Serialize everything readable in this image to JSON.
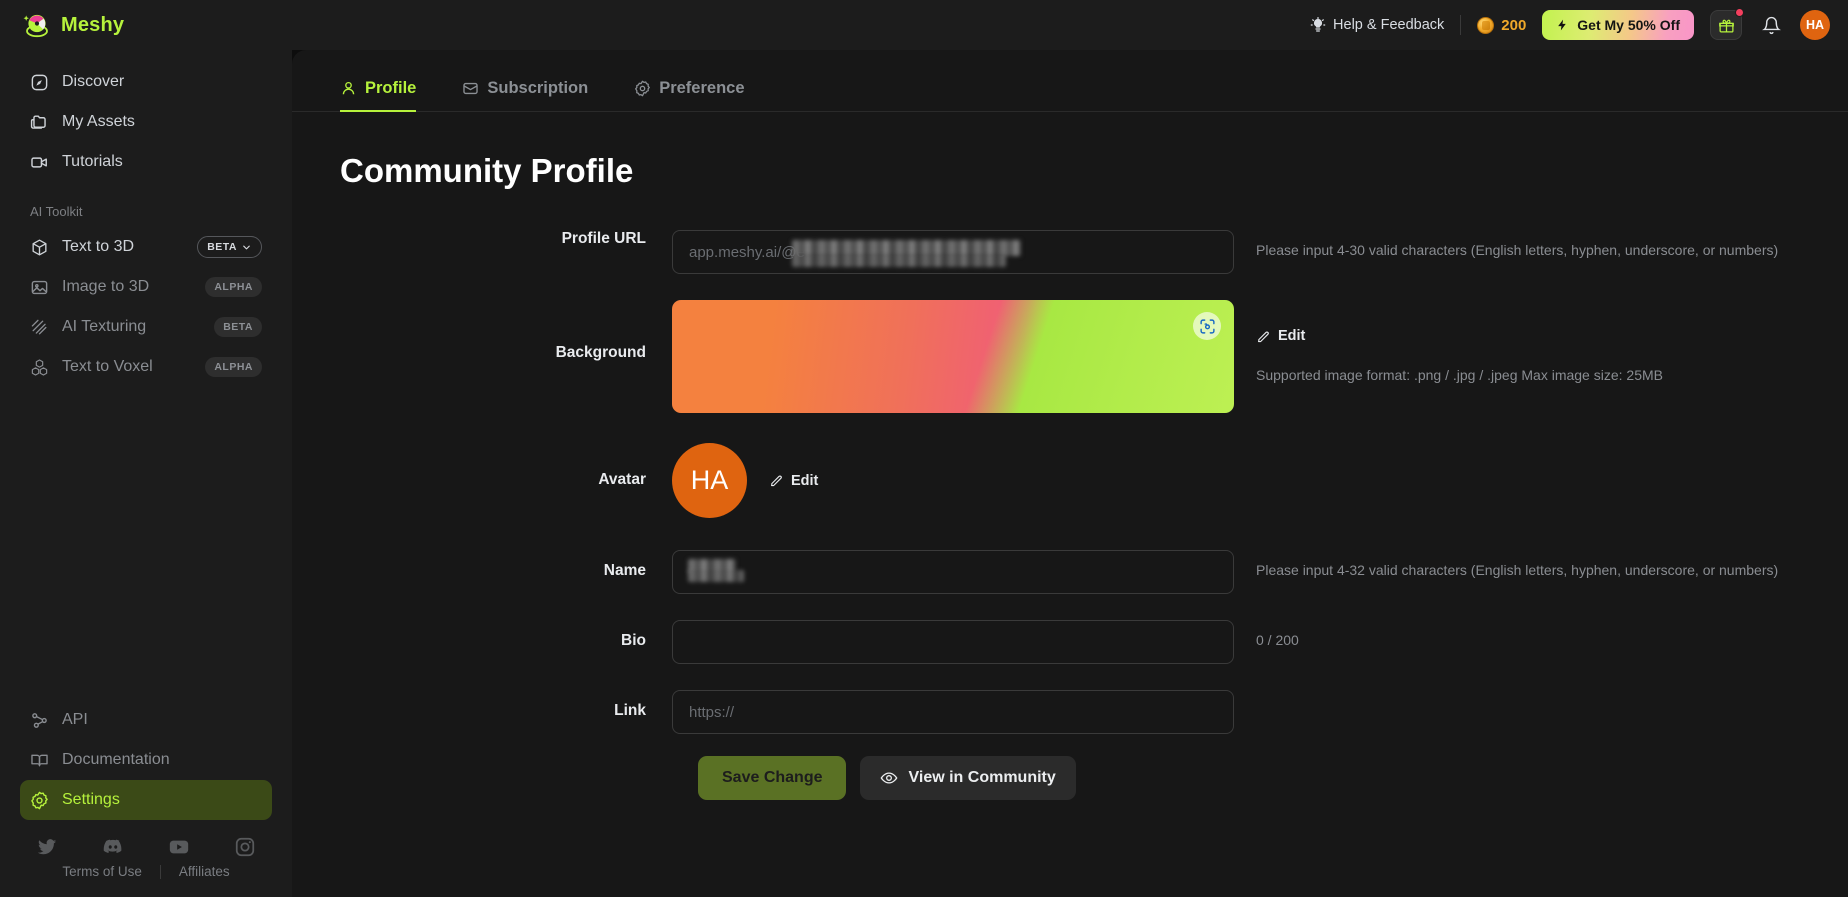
{
  "header": {
    "brand": "Meshy",
    "help_feedback": "Help & Feedback",
    "credits": "200",
    "promo": "Get My 50% Off",
    "avatar_initials": "HA",
    "icons": {
      "lightbulb": "lightbulb-icon",
      "coin": "coin-icon",
      "bolt": "bolt-icon",
      "gift": "gift-icon",
      "bell": "bell-icon"
    }
  },
  "sidebar": {
    "items": [
      {
        "label": "Discover",
        "icon": "compass-icon",
        "badge": null,
        "active": false
      },
      {
        "label": "My Assets",
        "icon": "folder-icon",
        "badge": null,
        "active": false
      },
      {
        "label": "Tutorials",
        "icon": "video-icon",
        "badge": null,
        "active": false
      }
    ],
    "section_title": "AI Toolkit",
    "toolkit": [
      {
        "label": "Text to 3D",
        "icon": "cube-icon",
        "badge": "BETA",
        "badge_style": "outline",
        "chevron": true
      },
      {
        "label": "Image to 3D",
        "icon": "image-icon",
        "badge": "ALPHA",
        "badge_style": "solid",
        "chevron": false
      },
      {
        "label": "AI Texturing",
        "icon": "texture-icon",
        "badge": "BETA",
        "badge_style": "solid",
        "chevron": false
      },
      {
        "label": "Text to Voxel",
        "icon": "voxel-icon",
        "badge": "ALPHA",
        "badge_style": "solid",
        "chevron": false
      }
    ],
    "bottom": [
      {
        "label": "API",
        "icon": "api-icon",
        "active": false
      },
      {
        "label": "Documentation",
        "icon": "book-icon",
        "active": false
      },
      {
        "label": "Settings",
        "icon": "gear-icon",
        "active": true
      }
    ],
    "socials": [
      "twitter-icon",
      "discord-icon",
      "youtube-icon",
      "instagram-icon"
    ],
    "legal": {
      "terms": "Terms of Use",
      "affiliates": "Affiliates"
    }
  },
  "tabs": [
    {
      "label": "Profile",
      "icon": "user-icon",
      "active": true
    },
    {
      "label": "Subscription",
      "icon": "card-icon",
      "active": false
    },
    {
      "label": "Preference",
      "icon": "gear-icon",
      "active": false
    }
  ],
  "page": {
    "title": "Community Profile",
    "profile_url": {
      "label": "Profile URL",
      "placeholder": "app.meshy.ai/@e",
      "value": "",
      "helper": "Please input 4-30 valid characters (English letters, hyphen, underscore, or numbers)"
    },
    "background": {
      "label": "Background",
      "edit": "Edit",
      "note": "Supported image format: .png / .jpg / .jpeg Max image size: 25MB",
      "gradient_from": "#f4813f",
      "gradient_mid": "#f05c7a",
      "gradient_to": "#bdf053",
      "overlay_icon": "scan-photo-icon"
    },
    "avatar": {
      "label": "Avatar",
      "initials": "HA",
      "edit": "Edit",
      "color": "#df6410"
    },
    "name": {
      "label": "Name",
      "value": "",
      "placeholder": "",
      "helper": "Please input 4-32 valid characters (English letters, hyphen, underscore, or numbers)"
    },
    "bio": {
      "label": "Bio",
      "value": "",
      "placeholder": "",
      "counter": "0 / 200"
    },
    "link": {
      "label": "Link",
      "value": "",
      "placeholder": "https://"
    },
    "actions": {
      "save": "Save Change",
      "view": "View in Community",
      "view_icon": "eye-icon"
    }
  }
}
